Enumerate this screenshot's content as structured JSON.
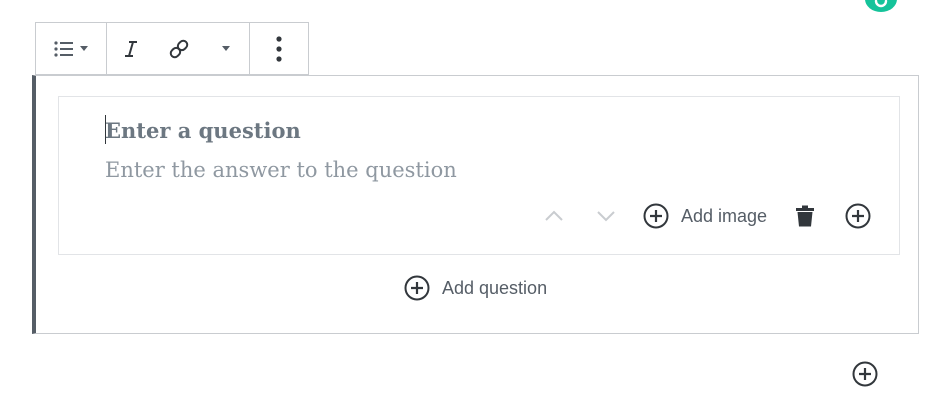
{
  "toolbar": {
    "buttons": [
      {
        "name": "list",
        "icon": "list-icon"
      },
      {
        "name": "italic",
        "icon": "italic-icon"
      },
      {
        "name": "link",
        "icon": "link-icon"
      },
      {
        "name": "more-formatting",
        "icon": "chevron-down-icon"
      },
      {
        "name": "more-options",
        "icon": "vertical-ellipsis-icon"
      }
    ]
  },
  "faq_block": {
    "question_placeholder": "Enter a question",
    "answer_placeholder": "Enter the answer to the question",
    "actions": {
      "add_image_label": "Add image"
    },
    "add_question_label": "Add question"
  },
  "colors": {
    "accent": "#555d66",
    "border": "#c9ccd0",
    "placeholder": "#8f98a1",
    "grammarly": "#15c39a"
  }
}
